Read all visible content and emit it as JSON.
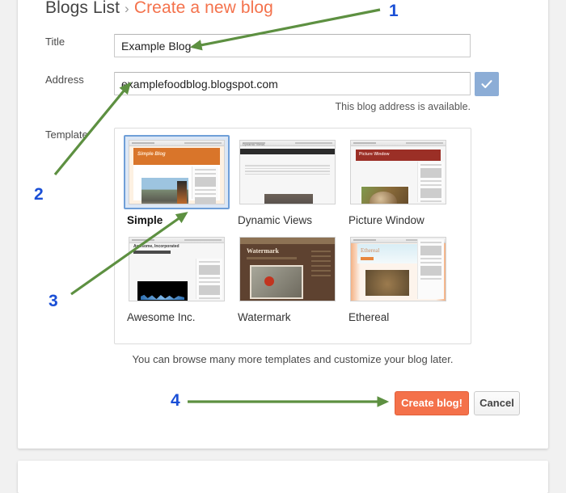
{
  "breadcrumb": {
    "parent": "Blogs List",
    "separator": "›",
    "current": "Create a new blog"
  },
  "form": {
    "title": {
      "label": "Title",
      "value": "Example Blog",
      "placeholder": ""
    },
    "address": {
      "label": "Address",
      "value": "examplefoodblog.blogspot.com",
      "placeholder": "",
      "status": "This blog address is available.",
      "ok_icon": "check-icon"
    },
    "template": {
      "label": "Template",
      "help": "You can browse many more templates and customize your blog later.",
      "selected": "Simple",
      "options": [
        {
          "name": "Simple",
          "selected": true,
          "thumb_title": "Simple Blog"
        },
        {
          "name": "Dynamic Views",
          "selected": false,
          "thumb_title": "Dynamic Views"
        },
        {
          "name": "Picture Window",
          "selected": false,
          "thumb_title": "Picture Window"
        },
        {
          "name": "Awesome Inc.",
          "selected": false,
          "thumb_title": "Awesome, Incorporated"
        },
        {
          "name": "Watermark",
          "selected": false,
          "thumb_title": "Watermark"
        },
        {
          "name": "Ethereal",
          "selected": false,
          "thumb_title": "Ethereal"
        }
      ]
    }
  },
  "actions": {
    "create_label": "Create blog!",
    "cancel_label": "Cancel"
  },
  "annotations": {
    "arrow_color": "#5d9041",
    "number_color": "#1a4fd6",
    "steps": [
      {
        "number": "1",
        "target": "title-input"
      },
      {
        "number": "2",
        "target": "address-input"
      },
      {
        "number": "3",
        "target": "template-simple"
      },
      {
        "number": "4",
        "target": "create-blog-button"
      }
    ]
  },
  "colors": {
    "accent_orange": "#f4714a",
    "breadcrumb_current": "#f4724c",
    "selection_blue": "#6f9fd8",
    "check_button_blue": "#8cadd6",
    "page_background": "#f1f1f1"
  }
}
